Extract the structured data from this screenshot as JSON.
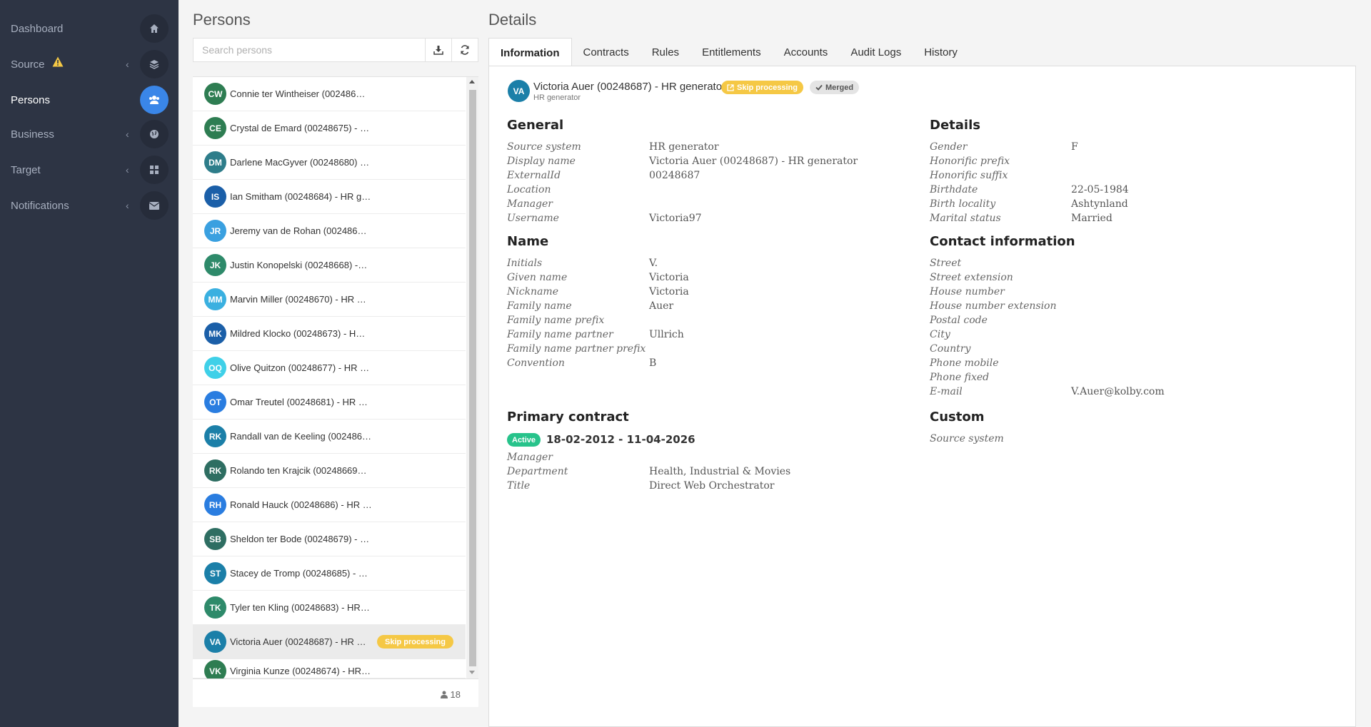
{
  "sidebar": {
    "items": [
      {
        "label": "Dashboard",
        "icon": "home-icon"
      },
      {
        "label": "Source",
        "icon": "layers-icon",
        "warning": true
      },
      {
        "label": "Persons",
        "icon": "users-icon"
      },
      {
        "label": "Business",
        "icon": "globe-icon"
      },
      {
        "label": "Target",
        "icon": "grid-icon"
      },
      {
        "label": "Notifications",
        "icon": "envelope-icon"
      }
    ]
  },
  "persons": {
    "title": "Persons",
    "search_placeholder": "Search persons",
    "count": "18",
    "list": [
      {
        "initials": "CW",
        "name": "Connie ter Wintheiser (002486…",
        "color": "#2e7d52"
      },
      {
        "initials": "CE",
        "name": "Crystal de Emard (00248675) - …",
        "color": "#2e7d52"
      },
      {
        "initials": "DM",
        "name": "Darlene MacGyver (00248680) …",
        "color": "#2e7d8a"
      },
      {
        "initials": "IS",
        "name": "Ian Smitham (00248684) - HR g…",
        "color": "#1b5fa8"
      },
      {
        "initials": "JR",
        "name": "Jeremy van de Rohan (002486…",
        "color": "#3aa0e0"
      },
      {
        "initials": "JK",
        "name": "Justin Konopelski (00248668) -…",
        "color": "#2e8a6a"
      },
      {
        "initials": "MM",
        "name": "Marvin Miller (00248670) - HR …",
        "color": "#3ab0e0"
      },
      {
        "initials": "MK",
        "name": "Mildred Klocko (00248673) - H…",
        "color": "#1b5fa8"
      },
      {
        "initials": "OQ",
        "name": "Olive Quitzon (00248677) - HR …",
        "color": "#3fd0e8"
      },
      {
        "initials": "OT",
        "name": "Omar Treutel (00248681) - HR …",
        "color": "#2a7de0"
      },
      {
        "initials": "RK",
        "name": "Randall van de Keeling (002486…",
        "color": "#1b7fa8"
      },
      {
        "initials": "RK",
        "name": "Rolando ten Krajcik (00248669…",
        "color": "#2e6e62"
      },
      {
        "initials": "RH",
        "name": "Ronald Hauck (00248686) - HR …",
        "color": "#2a7de0"
      },
      {
        "initials": "SB",
        "name": "Sheldon ter Bode (00248679) - …",
        "color": "#2e6e62"
      },
      {
        "initials": "ST",
        "name": "Stacey de Tromp (00248685) - …",
        "color": "#1b7fa8"
      },
      {
        "initials": "TK",
        "name": "Tyler ten Kling (00248683) - HR…",
        "color": "#2e8a6a"
      },
      {
        "initials": "VA",
        "name": "Victoria Auer (00248687) - HR …",
        "color": "#1b7fa8",
        "badge": "Skip processing",
        "selected": true
      },
      {
        "initials": "VK",
        "name": "Virginia Kunze (00248674) - HR…",
        "color": "#2e7d52"
      }
    ]
  },
  "details": {
    "title": "Details",
    "tabs": [
      "Information",
      "Contracts",
      "Rules",
      "Entitlements",
      "Accounts",
      "Audit Logs",
      "History"
    ],
    "header": {
      "initials": "VA",
      "name": "Victoria Auer (00248687) - HR generator",
      "subtitle": "HR generator",
      "skip_badge": "Skip processing",
      "merged_badge": "Merged"
    },
    "general": {
      "title": "General",
      "rows": [
        {
          "label": "Source system",
          "value": "HR generator"
        },
        {
          "label": "Display name",
          "value": "Victoria Auer (00248687) - HR generator"
        },
        {
          "label": "ExternalId",
          "value": "00248687"
        },
        {
          "label": "Location",
          "value": ""
        },
        {
          "label": "Manager",
          "value": ""
        },
        {
          "label": "Username",
          "value": "Victoria97"
        }
      ]
    },
    "name": {
      "title": "Name",
      "rows": [
        {
          "label": "Initials",
          "value": "V."
        },
        {
          "label": "Given name",
          "value": "Victoria"
        },
        {
          "label": "Nickname",
          "value": "Victoria"
        },
        {
          "label": "Family name",
          "value": "Auer"
        },
        {
          "label": "Family name prefix",
          "value": ""
        },
        {
          "label": "Family name partner",
          "value": "Ullrich"
        },
        {
          "label": "Family name partner prefix",
          "value": ""
        },
        {
          "label": "Convention",
          "value": "B"
        }
      ]
    },
    "contract": {
      "title": "Primary contract",
      "status": "Active",
      "dates": "18-02-2012 - 11-04-2026",
      "rows": [
        {
          "label": "Manager",
          "value": ""
        },
        {
          "label": "Department",
          "value": "Health, Industrial & Movies"
        },
        {
          "label": "Title",
          "value": "Direct Web Orchestrator"
        }
      ]
    },
    "details_section": {
      "title": "Details",
      "rows": [
        {
          "label": "Gender",
          "value": "F"
        },
        {
          "label": "Honorific prefix",
          "value": ""
        },
        {
          "label": "Honorific suffix",
          "value": ""
        },
        {
          "label": "Birthdate",
          "value": "22-05-1984"
        },
        {
          "label": "Birth locality",
          "value": "Ashtynland"
        },
        {
          "label": "Marital status",
          "value": "Married"
        }
      ]
    },
    "contact": {
      "title": "Contact information",
      "rows": [
        {
          "label": "Street",
          "value": ""
        },
        {
          "label": "Street extension",
          "value": ""
        },
        {
          "label": "House number",
          "value": ""
        },
        {
          "label": "House number extension",
          "value": ""
        },
        {
          "label": "Postal code",
          "value": ""
        },
        {
          "label": "City",
          "value": ""
        },
        {
          "label": "Country",
          "value": ""
        },
        {
          "label": "Phone mobile",
          "value": ""
        },
        {
          "label": "Phone fixed",
          "value": ""
        },
        {
          "label": "E-mail",
          "value": "V.Auer@kolby.com"
        }
      ]
    },
    "custom": {
      "title": "Custom",
      "rows": [
        {
          "label": "Source system",
          "value": ""
        }
      ]
    }
  }
}
